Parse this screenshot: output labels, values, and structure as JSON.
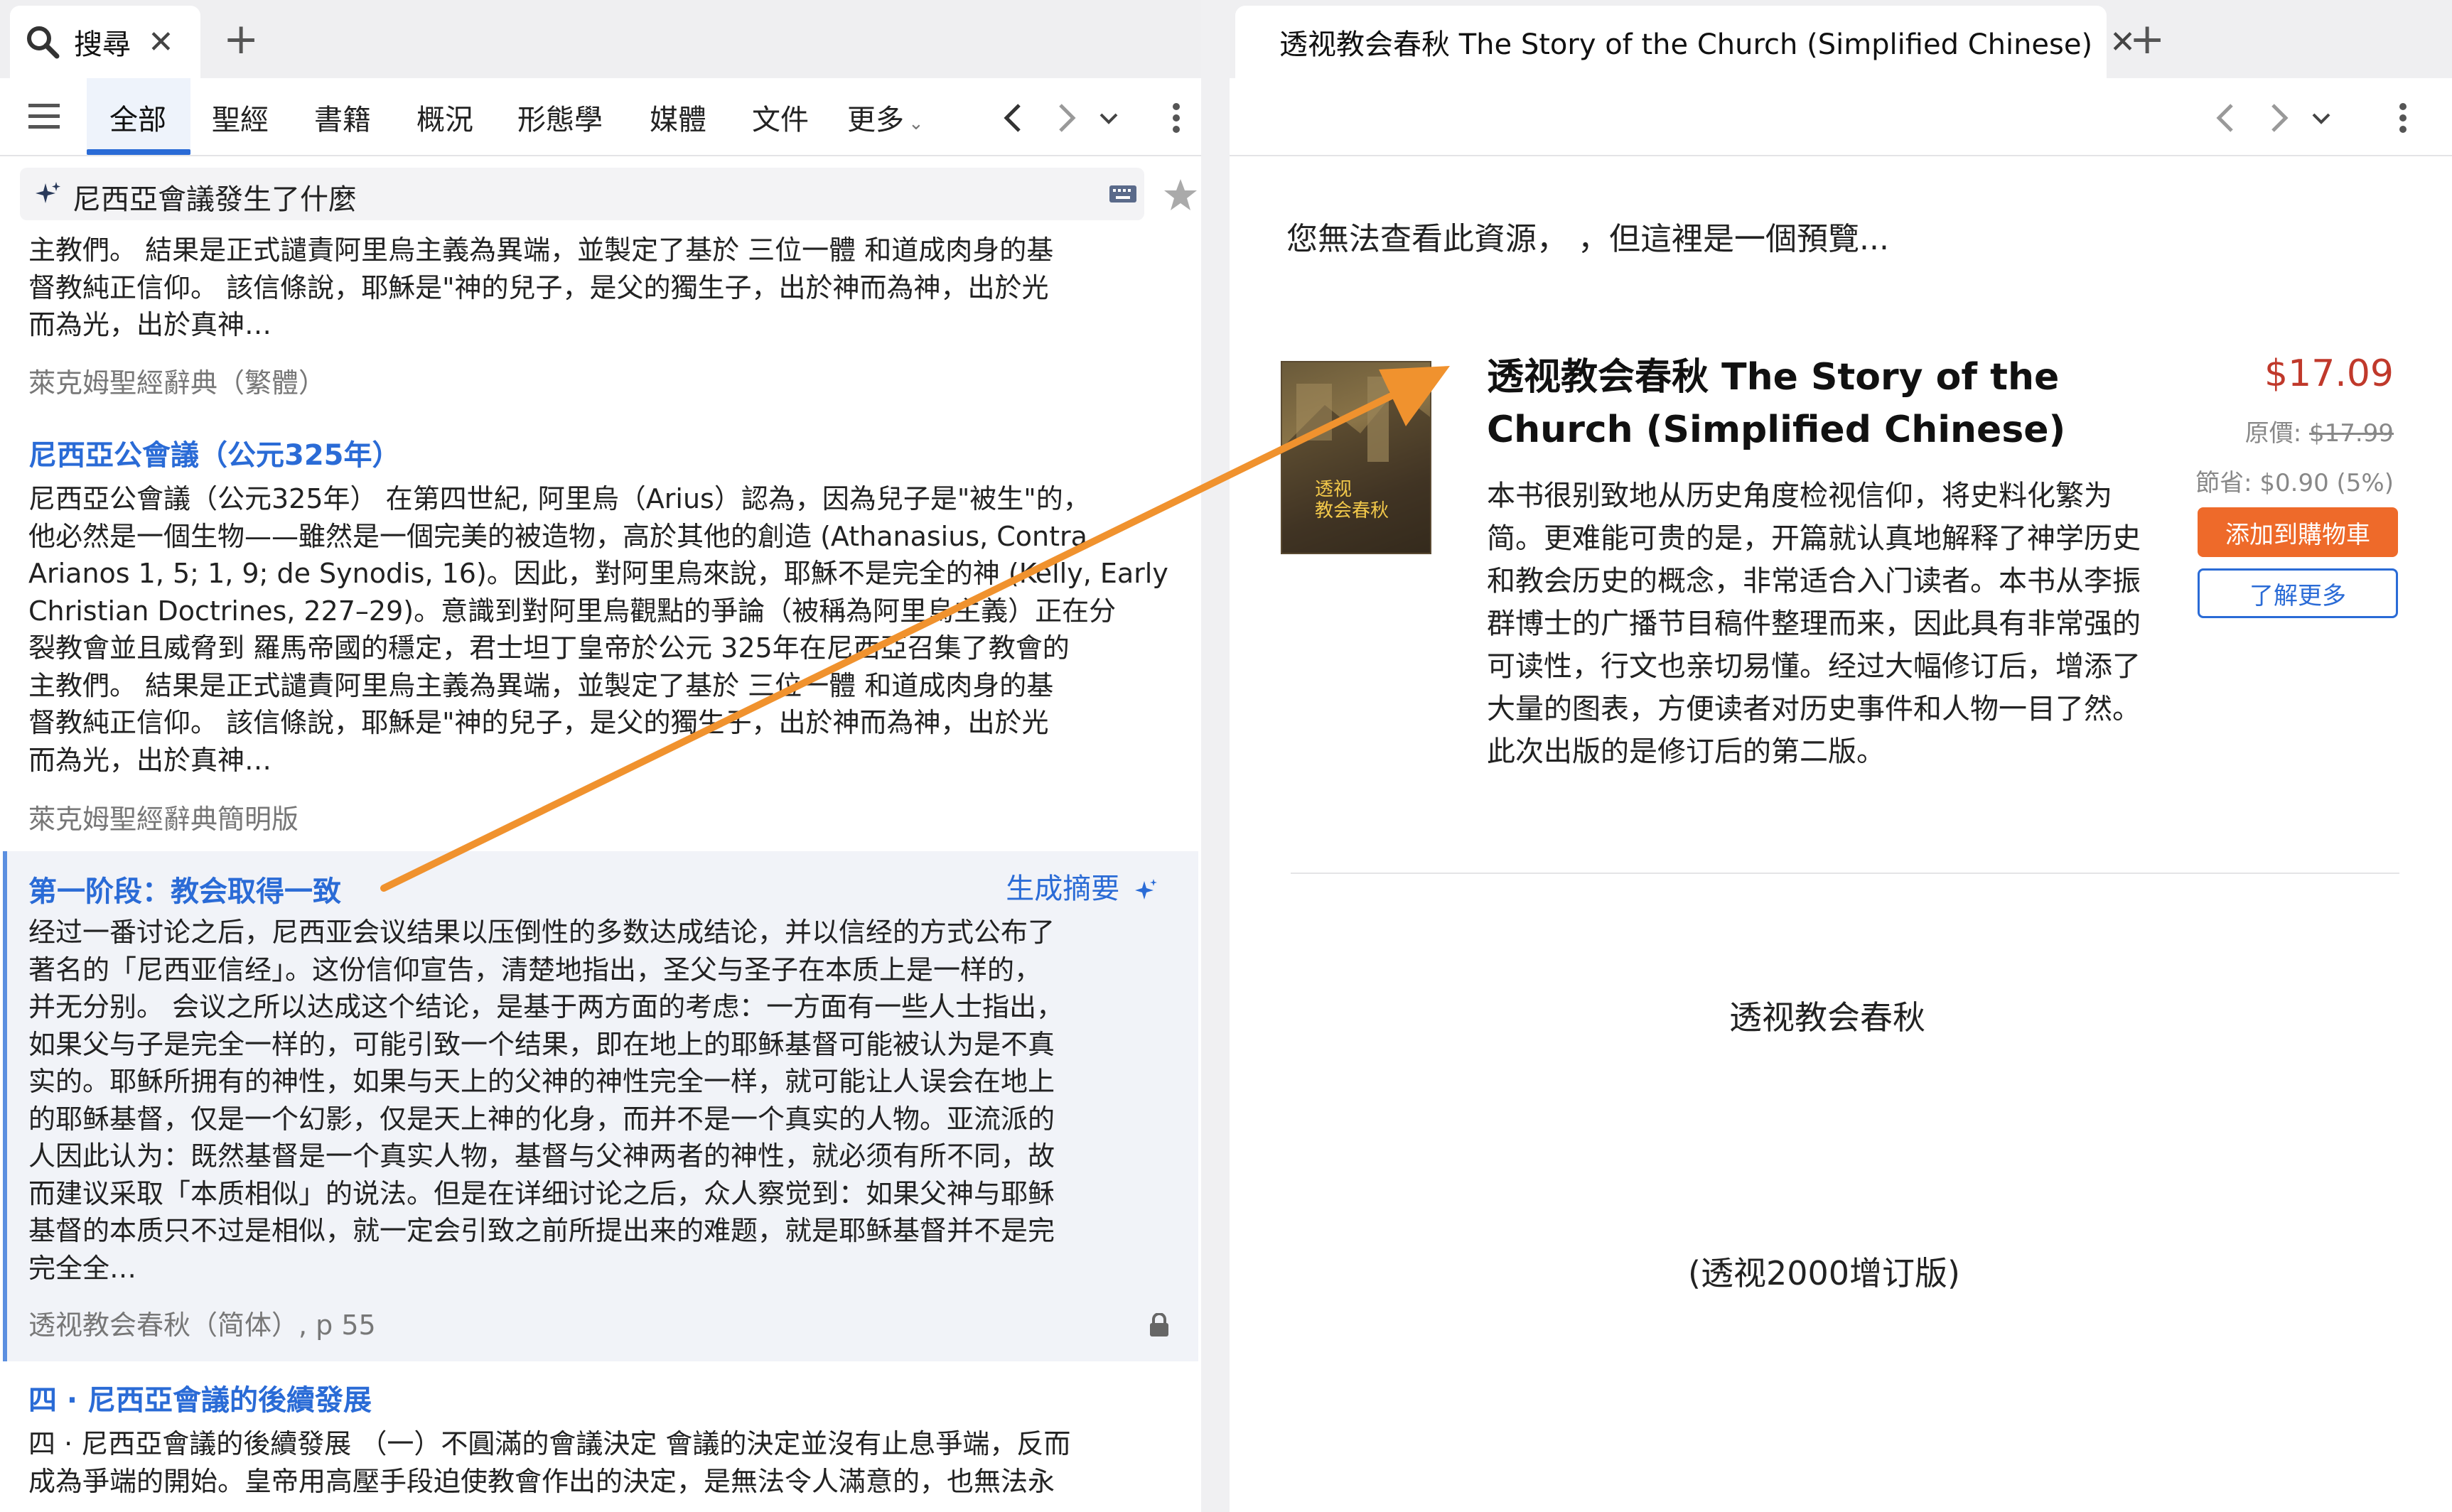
{
  "left": {
    "tab": {
      "title": "搜尋"
    },
    "nav": {
      "items": [
        "全部",
        "聖經",
        "書籍",
        "概況",
        "形態學",
        "媒體",
        "文件",
        "更多"
      ]
    },
    "search": {
      "query": "尼西亞會議發生了什麼"
    },
    "results": [
      {
        "lines": [
          "主教們。 結果是正式譴責阿里烏主義為異端，並製定了基於 三位一體 和道成肉身的基",
          "督教純正信仰。 該信條說，耶穌是\"神的兒子，是父的獨生子，出於神而為神，出於光",
          "而為光，出於真神…"
        ],
        "source": "萊克姆聖經辭典（繁體）"
      },
      {
        "heading": "尼西亞公會議（公元325年）",
        "lines": [
          "尼西亞公會議（公元325年） 在第四世紀, 阿里烏（Arius）認為，因為兒子是\"被生\"的，",
          "他必然是一個生物——雖然是一個完美的被造物，高於其他的創造 (Athanasius, Contra",
          "Arianos 1, 5; 1, 9; de Synodis, 16)。因此，對阿里烏來說，耶穌不是完全的神 (Kelly, Early",
          "Christian Doctrines, 227–29)。意識到對阿里烏觀點的爭論（被稱為阿里烏主義）正在分",
          "裂教會並且威脅到 羅馬帝國的穩定，君士坦丁皇帝於公元 325年在尼西亞召集了教會的",
          "主教們。 結果是正式譴責阿里烏主義為異端，並製定了基於 三位一體 和道成肉身的基",
          "督教純正信仰。 該信條說，耶穌是\"神的兒子，是父的獨生子，出於神而為神，出於光",
          "而為光，出於真神…"
        ],
        "source": "萊克姆聖經辭典簡明版"
      },
      {
        "heading": "第一阶段：教会取得一致",
        "action": "生成摘要",
        "lines": [
          "经过一番讨论之后，尼西亚会议结果以压倒性的多数达成结论，并以信经的方式公布了",
          "著名的「尼西亚信经」。这份信仰宣告，清楚地指出，圣父与圣子在本质上是一样的，",
          "并无分别。 会议之所以达成这个结论，是基于两方面的考虑：一方面有一些人士指出，",
          "如果父与子是完全一样的，可能引致一个结果，即在地上的耶稣基督可能被认为是不真",
          "实的。耶稣所拥有的神性，如果与天上的父神的神性完全一样，就可能让人误会在地上",
          "的耶稣基督，仅是一个幻影，仅是天上神的化身，而并不是一个真实的人物。亚流派的",
          "人因此认为：既然基督是一个真实人物，基督与父神两者的神性，就必须有所不同，故",
          "而建议采取「本质相似」的说法。但是在详细讨论之后，众人察觉到：如果父神与耶稣",
          "基督的本质只不过是相似，就一定会引致之前所提出来的难题，就是耶稣基督并不是完",
          "完全全…"
        ],
        "source": "透视教会春秋（简体）, p 55"
      },
      {
        "heading": "四 · 尼西亞會議的後續發展",
        "lines": [
          "四 · 尼西亞會議的後續發展 （一）不圓滿的會議決定 會議的決定並沒有止息爭端，反而",
          "成為爭端的開始。皇帝用高壓手段迫使教會作出的決定，是無法令人滿意的，也無法永"
        ]
      }
    ]
  },
  "right": {
    "tab": {
      "title": "透视教会春秋 The Story of the Church (Simplified Chinese)"
    },
    "notice": "您無法查看此資源， ，但這裡是一個預覽...",
    "book": {
      "cover_text": [
        "透视",
        "教会春秋"
      ],
      "title": "透视教会春秋 The Story of the Church (Simplified Chinese)",
      "description": "本书很别致地从历史角度检视信仰，将史料化繁为简。更难能可贵的是，开篇就认真地解释了神学历史和教会历史的概念，非常适合入门读者。本书从李振群博士的广播节目稿件整理而来，因此具有非常强的可读性，行文也亲切易懂。经过大幅修订后，增添了大量的图表，方便读者对历史事件和人物一目了然。此次出版的是修订后的第二版。",
      "price": "$17.09",
      "orig_label": "原價: ",
      "orig_price": "$17.99",
      "savings": "節省: $0.90 (5%)",
      "cart_label": "添加到購物車",
      "more_label": "了解更多"
    },
    "preview": [
      "透视教会春秋",
      "(透视2000增订版)"
    ]
  },
  "colors": {
    "link": "#2a6bd6",
    "price": "#c0392b",
    "cart": "#ee6a2a",
    "arrow": "#f0922e"
  },
  "icons": [
    "search-icon",
    "close-icon",
    "plus-icon",
    "hamburger-icon",
    "chevron-left-icon",
    "chevron-right-icon",
    "chevron-down-icon",
    "kebab-icon",
    "sparkle-icon",
    "keyboard-icon",
    "star-icon",
    "lock-icon",
    "book-icon"
  ]
}
